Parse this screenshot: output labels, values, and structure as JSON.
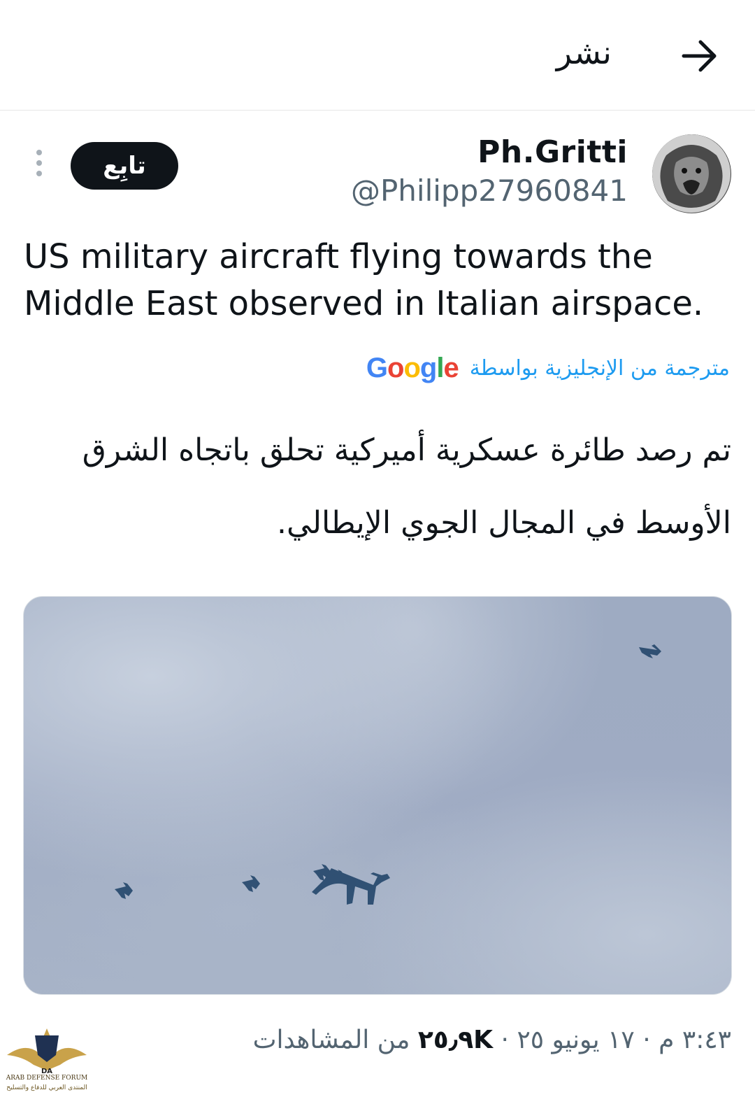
{
  "header": {
    "title": "نشر",
    "back_icon": "arrow-right-icon"
  },
  "tweet": {
    "author_name": "Ph.Gritti",
    "author_handle": "@Philipp27960841",
    "follow_label": "تابِع",
    "text_lines": [
      "US military aircraft flying towards the",
      "Middle East observed in Italian airspace."
    ],
    "translated_from": "مترجمة من الإنجليزية بواسطة",
    "translator_brand": "Google",
    "translation_lines": [
      "تم رصد طائرة عسكرية أميركية تحلق باتجاه الشرق",
      "الأوسط في المجال الجوي الإيطالي."
    ],
    "meta_time": "٣:٤٣ م",
    "meta_date": "١٧ يونيو ٢٥",
    "meta_views": "٢٥٫٩K",
    "meta_views_label": "من المشاهدات",
    "separator": "·"
  },
  "watermark": {
    "line1": "ARAB DEFENSE FORUM",
    "line2": "المنتدى العربي للدفاع والتسليح",
    "logo_text": "DA"
  },
  "colors": {
    "accent": "#1d9bf0",
    "text": "#0f1419",
    "secondary": "#536471",
    "sky": "#9eabc2"
  }
}
